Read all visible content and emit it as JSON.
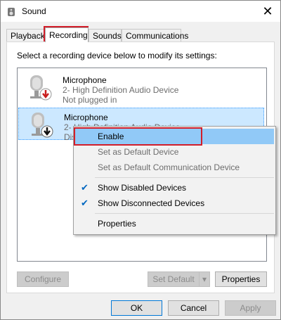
{
  "window": {
    "title": "Sound",
    "icon": "speaker-icon",
    "close": "✕"
  },
  "tabs": [
    {
      "label": "Playback"
    },
    {
      "label": "Recording"
    },
    {
      "label": "Sounds"
    },
    {
      "label": "Communications"
    }
  ],
  "panel": {
    "instructions": "Select a recording device below to modify its settings:",
    "devices": [
      {
        "name": "Microphone",
        "description": "2- High Definition Audio Device",
        "status": "Not plugged in",
        "badge": "red-down-arrow"
      },
      {
        "name": "Microphone",
        "description": "2- High Definition Audio Device",
        "status": "Dis",
        "badge": "black-down-arrow"
      }
    ],
    "buttons": {
      "configure": "Configure",
      "set_default": "Set Default",
      "properties": "Properties"
    }
  },
  "context_menu": {
    "items": [
      {
        "label": "Enable",
        "state": "highlighted"
      },
      {
        "label": "Set as Default Device",
        "state": "disabled"
      },
      {
        "label": "Set as Default Communication Device",
        "state": "disabled"
      },
      {
        "label": "Show Disabled Devices",
        "checked": true
      },
      {
        "label": "Show Disconnected Devices",
        "checked": true
      },
      {
        "label": "Properties"
      }
    ],
    "check_glyph": "✔"
  },
  "footer": {
    "ok": "OK",
    "cancel": "Cancel",
    "apply": "Apply"
  },
  "colors": {
    "highlight_red": "#d21e2a",
    "selection": "#cce8ff",
    "menu_highlight": "#91c9f7",
    "accent": "#0078d7"
  }
}
